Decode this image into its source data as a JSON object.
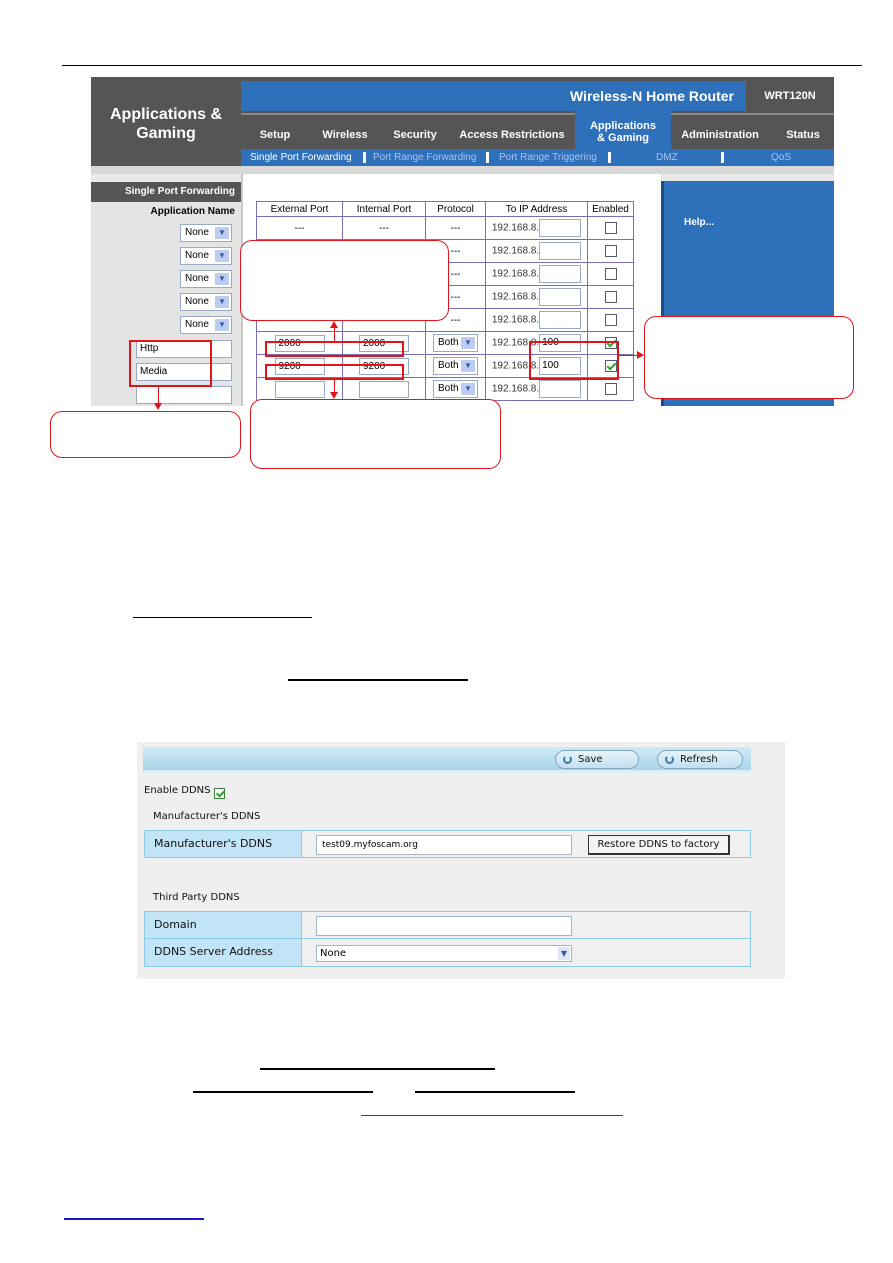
{
  "router": {
    "section_title": "Applications & Gaming",
    "product_name": "Wireless-N Home Router",
    "model": "WRT120N",
    "tabs": [
      {
        "label": "Setup",
        "active": false
      },
      {
        "label": "Wireless",
        "active": false
      },
      {
        "label": "Security",
        "active": false
      },
      {
        "label": "Access Restrictions",
        "active": false
      },
      {
        "label": "Applications & Gaming",
        "active": true
      },
      {
        "label": "Administration",
        "active": false
      },
      {
        "label": "Status",
        "active": false
      }
    ],
    "subtabs": [
      {
        "label": "Single Port Forwarding",
        "active": true
      },
      {
        "label": "Port Range Forwarding",
        "active": false
      },
      {
        "label": "Port Range Triggering",
        "active": false
      },
      {
        "label": "DMZ",
        "active": false
      },
      {
        "label": "QoS",
        "active": false
      }
    ],
    "sidebar_heading": "Single Port Forwarding",
    "application_name_label": "Application Name",
    "help_text": "Help...",
    "table": {
      "headers": [
        "External Port",
        "Internal Port",
        "Protocol",
        "To IP Address",
        "Enabled"
      ],
      "ip_prefix": "192.168.8.",
      "rows": [
        {
          "app": "None",
          "app_type": "select",
          "external": "---",
          "internal": "---",
          "protocol": "---",
          "ip_suffix": "",
          "enabled": false
        },
        {
          "app": "None",
          "app_type": "select",
          "external": "---",
          "internal": "---",
          "protocol": "---",
          "ip_suffix": "",
          "enabled": false
        },
        {
          "app": "None",
          "app_type": "select",
          "external": "---",
          "internal": "---",
          "protocol": "---",
          "ip_suffix": "",
          "enabled": false
        },
        {
          "app": "None",
          "app_type": "select",
          "external": "---",
          "internal": "---",
          "protocol": "---",
          "ip_suffix": "",
          "enabled": false
        },
        {
          "app": "None",
          "app_type": "select",
          "external": "---",
          "internal": "---",
          "protocol": "---",
          "ip_suffix": "",
          "enabled": false
        },
        {
          "app": "Http",
          "app_type": "input",
          "external": "2000",
          "internal": "2000",
          "protocol": "Both",
          "ip_suffix": "100",
          "enabled": true
        },
        {
          "app": "Media",
          "app_type": "input",
          "external": "9200",
          "internal": "9200",
          "protocol": "Both",
          "ip_suffix": "100",
          "enabled": true
        },
        {
          "app": "",
          "app_type": "input",
          "external": "",
          "internal": "",
          "protocol": "Both",
          "ip_suffix": "",
          "enabled": false
        }
      ]
    }
  },
  "ddns": {
    "save_label": "Save",
    "refresh_label": "Refresh",
    "enable_label": "Enable DDNS",
    "enabled": true,
    "manufacturer_section": "Manufacturer's DDNS",
    "manufacturer_field_label": "Manufacturer's DDNS",
    "manufacturer_value": "test09.myfoscam.org",
    "restore_label": "Restore DDNS to factory",
    "third_party_section": "Third Party DDNS",
    "domain_label": "Domain",
    "domain_value": "",
    "server_label": "DDNS Server Address",
    "server_value": "None"
  },
  "colors": {
    "router_blue": "#2e70b9",
    "router_gray": "#555555",
    "annotation_red": "#e0141b",
    "ddns_header_blue": "#c1e4f6"
  }
}
